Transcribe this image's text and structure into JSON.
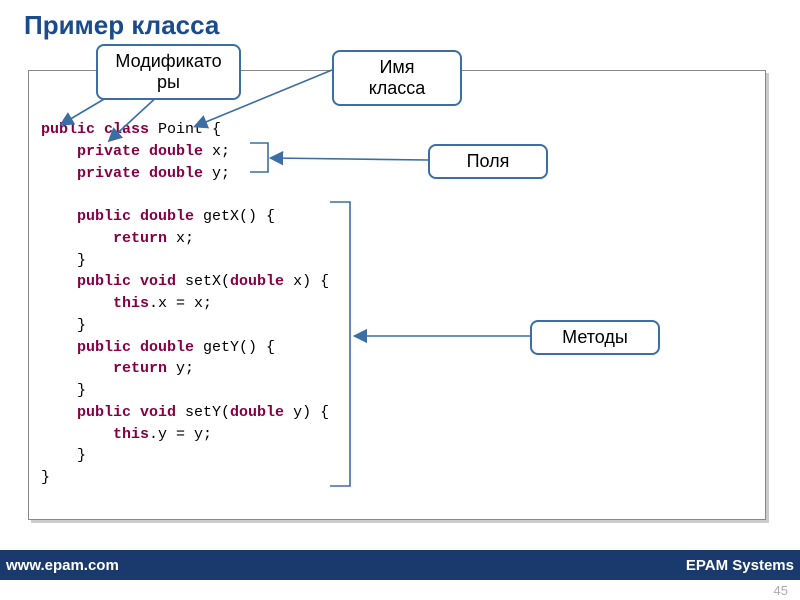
{
  "title": "Пример класса",
  "callouts": {
    "modifiers": "Модификато\nры",
    "classname": "Имя класса",
    "fields": "Поля",
    "methods": "Методы"
  },
  "code": {
    "l1a": "public class",
    "l1b": " Point {",
    "l2a": "    private double",
    "l2b": " x;",
    "l3a": "    private double",
    "l3b": " y;",
    "l5a": "    public double",
    "l5b": " getX() {",
    "l6a": "        return",
    "l6b": " x;",
    "l7": "    }",
    "l8a": "    public void",
    "l8b": " setX(",
    "l8c": "double",
    "l8d": " x) {",
    "l9a": "        this",
    "l9b": ".x = x;",
    "l10": "    }",
    "l11a": "    public double",
    "l11b": " getY() {",
    "l12a": "        return",
    "l12b": " y;",
    "l13": "    }",
    "l14a": "    public void",
    "l14b": " setY(",
    "l14c": "double",
    "l14d": " y) {",
    "l15a": "        this",
    "l15b": ".y = y;",
    "l16": "    }",
    "l17": "}"
  },
  "footer": {
    "url": "www.epam.com",
    "company": "EPAM Systems"
  },
  "page": "45"
}
